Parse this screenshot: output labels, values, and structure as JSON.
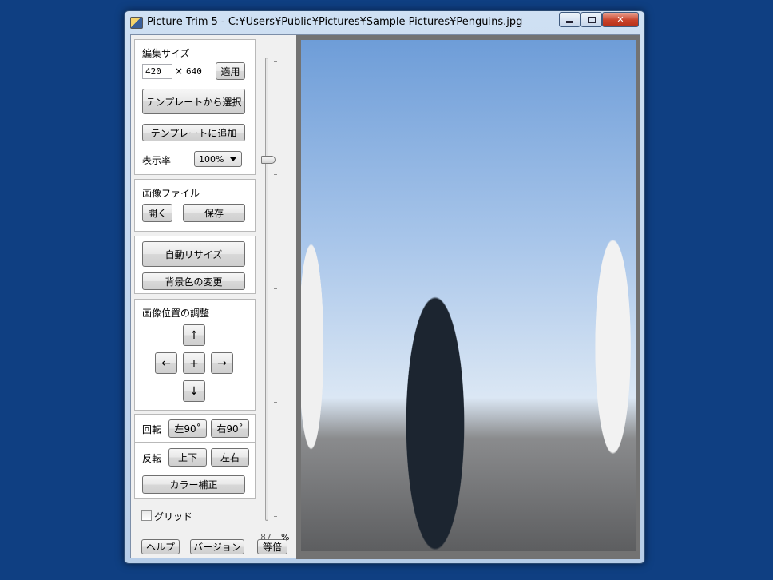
{
  "window": {
    "title": "Picture Trim 5 - C:¥Users¥Public¥Pictures¥Sample Pictures¥Penguins.jpg",
    "controls": {
      "minimize": "",
      "maximize": "",
      "close": "✕"
    }
  },
  "edit_size": {
    "heading": "編集サイズ",
    "width": "420",
    "times": "×",
    "height": "640",
    "apply_label": "適用",
    "select_template_label": "テンプレートから選択",
    "add_template_label": "テンプレートに追加",
    "zoom_label": "表示率",
    "zoom_value": "100%"
  },
  "image_file": {
    "heading": "画像ファイル",
    "open_label": "開く",
    "save_label": "保存"
  },
  "actions": {
    "auto_resize_label": "自動リサイズ",
    "bg_color_label": "背景色の変更"
  },
  "position": {
    "heading": "画像位置の調整",
    "up": "↑",
    "left": "←",
    "center": "+",
    "right": "→",
    "down": "↓"
  },
  "rotate": {
    "label": "回転",
    "left_label": "左90˚",
    "right_label": "右90˚"
  },
  "flip": {
    "label": "反転",
    "vertical_label": "上下",
    "horizontal_label": "左右"
  },
  "color_correct_label": "カラー補正",
  "grid_label": "グリッド",
  "slider": {
    "value": "87",
    "unit": "%"
  },
  "footer": {
    "help_label": "ヘルプ",
    "version_label": "バージョン",
    "actual_size_label": "等倍"
  },
  "image": {
    "alt": "Penguins"
  }
}
